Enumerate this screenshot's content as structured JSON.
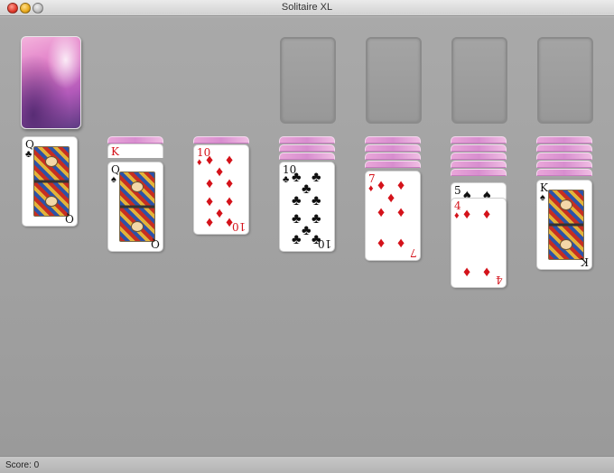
{
  "window": {
    "title": "Solitaire XL"
  },
  "stock": {
    "label": "stock-deck"
  },
  "foundations": [
    {},
    {},
    {},
    {}
  ],
  "tableau": {
    "col1": {
      "top_rank": "Q",
      "top_suit": "♣"
    },
    "col2": {
      "back_rank": "K",
      "top_rank": "Q",
      "top_suit": "♠"
    },
    "col3": {
      "top_rank": "10",
      "top_suit": "♦"
    },
    "col4": {
      "top_rank": "10",
      "top_suit": "♣"
    },
    "col5": {
      "top_rank": "7",
      "top_suit": "♦"
    },
    "col6": {
      "card5_rank": "5",
      "card5_suit": "♠",
      "top_rank": "4",
      "top_suit": "♦"
    },
    "col7": {
      "top_rank": "K",
      "top_suit": "♠"
    }
  },
  "status": {
    "score": "Score: 0"
  },
  "colors": {
    "red": "#d4121a",
    "black": "#111111",
    "felt": "#a3a3a3",
    "card_back": "#e07cc7"
  }
}
